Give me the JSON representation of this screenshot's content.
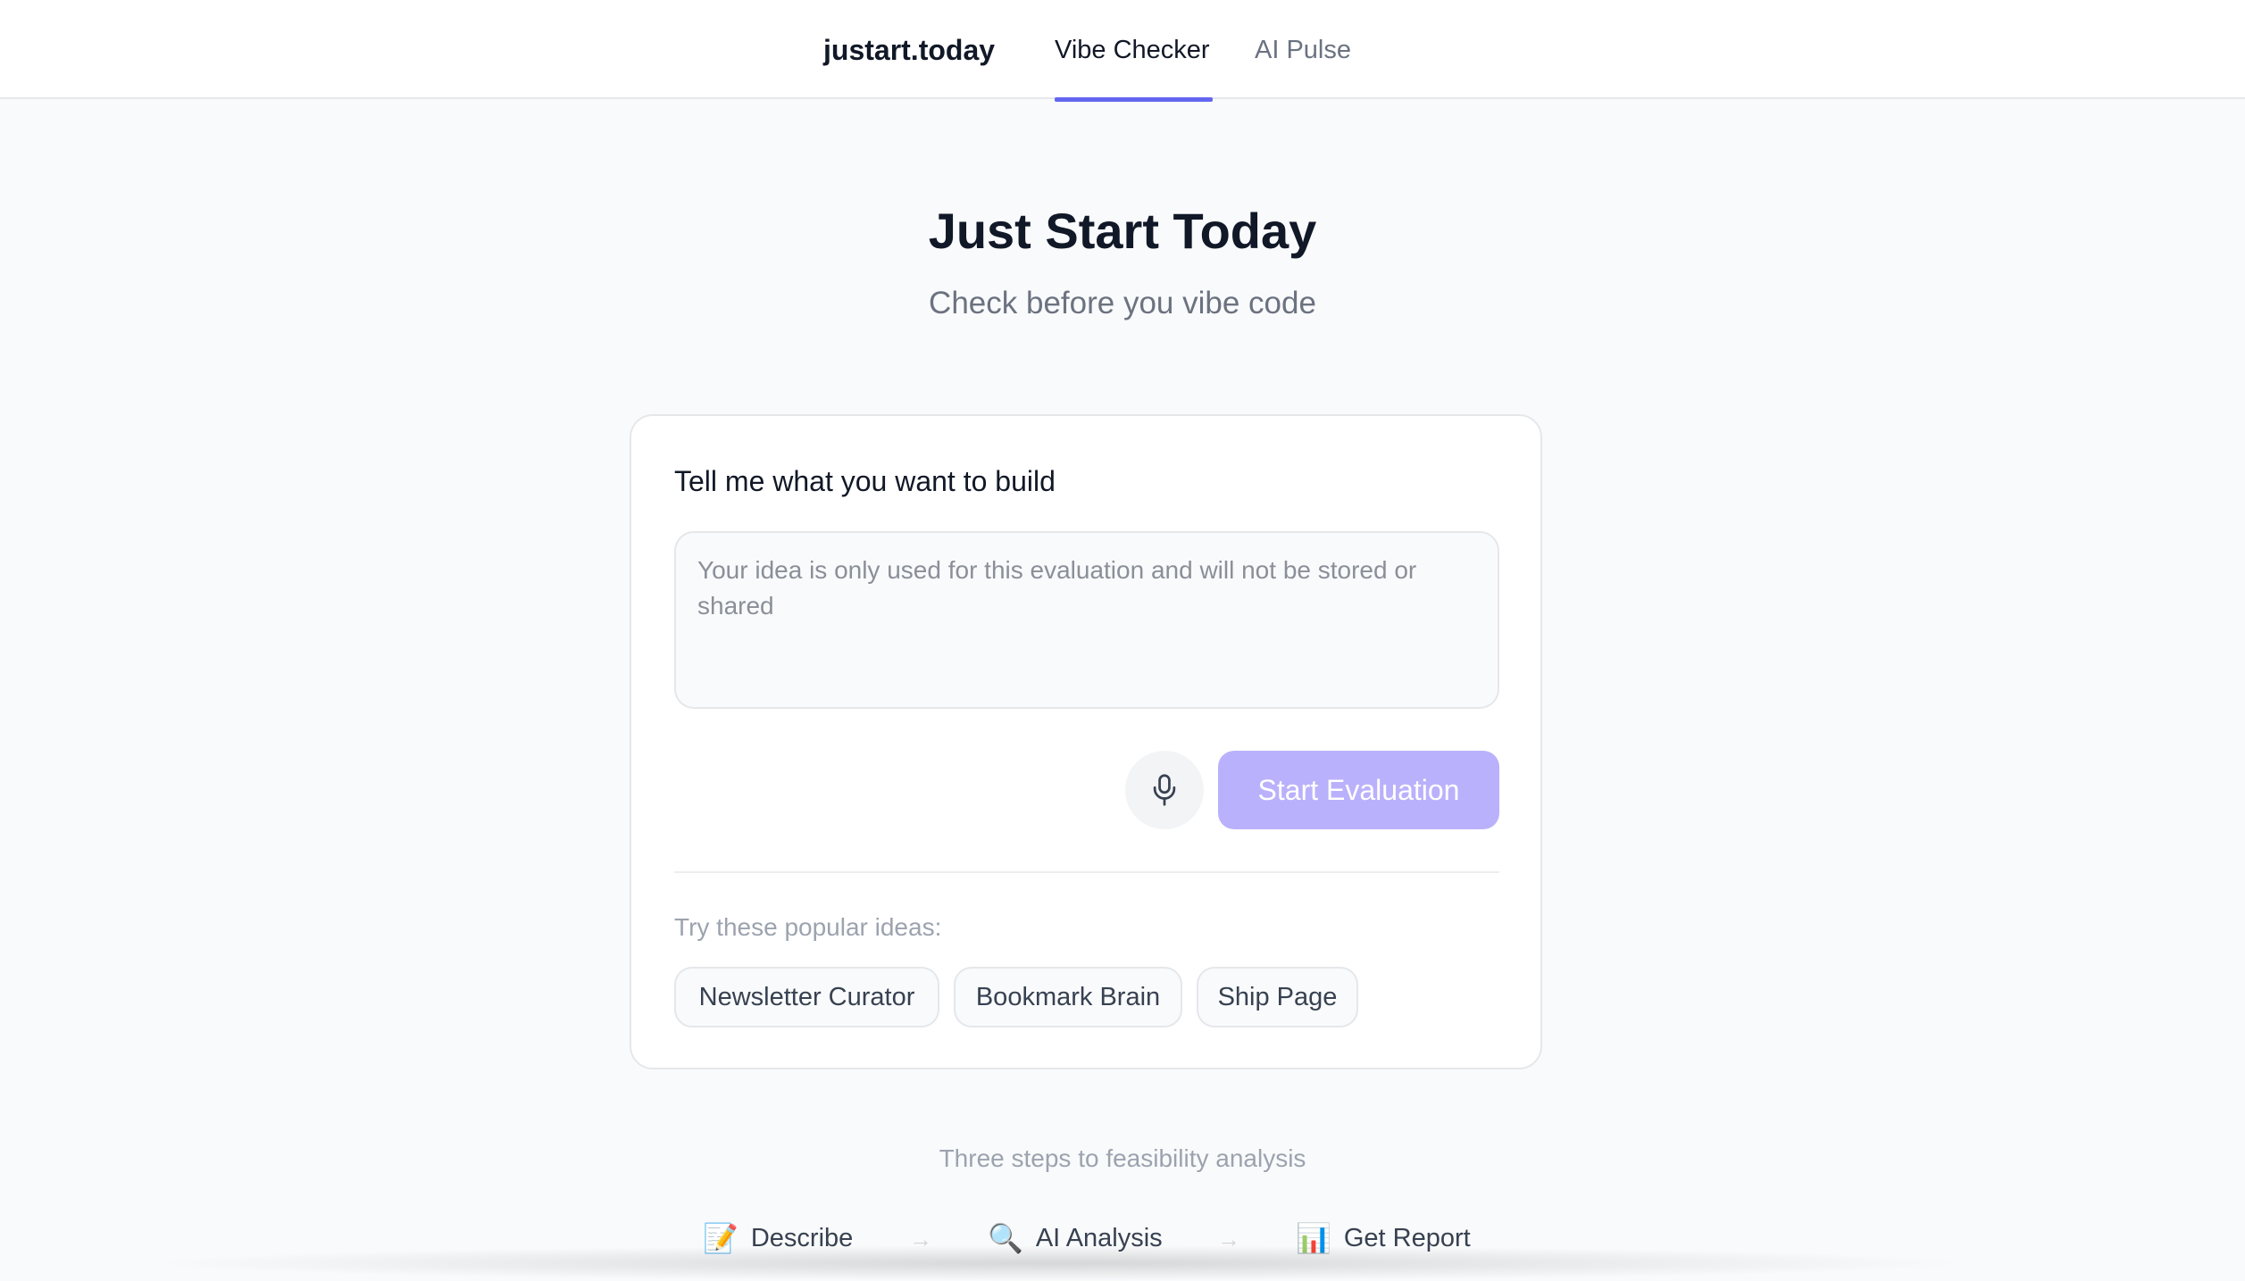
{
  "nav": {
    "brand": "justart.today",
    "tabs": [
      {
        "label": "Vibe Checker",
        "active": true
      },
      {
        "label": "AI Pulse",
        "active": false
      }
    ]
  },
  "hero": {
    "title": "Just Start Today",
    "subtitle": "Check before you vibe code"
  },
  "card": {
    "label": "Tell me what you want to build",
    "input": {
      "value": "",
      "placeholder": "Your idea is only used for this evaluation and will not be stored or shared"
    },
    "mic_icon": "microphone-icon",
    "start_button": "Start Evaluation",
    "ideas_label": "Try these popular ideas:",
    "ideas": [
      "Newsletter Curator",
      "Bookmark Brain",
      "Ship Page"
    ]
  },
  "steps": {
    "title": "Three steps to feasibility analysis",
    "items": [
      {
        "icon": "📝",
        "label": "Describe"
      },
      {
        "icon": "🔍",
        "label": "AI Analysis"
      },
      {
        "icon": "📊",
        "label": "Get Report"
      }
    ],
    "arrow": "→"
  },
  "colors": {
    "accent": "#6366f1",
    "button_disabled": "#b9b1fb",
    "background": "#f9fafb"
  }
}
